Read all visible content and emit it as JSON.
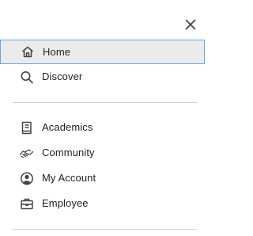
{
  "close": {
    "icon": "close-icon"
  },
  "nav": {
    "primary": [
      {
        "label": "Home",
        "icon": "home-icon",
        "active": true
      },
      {
        "label": "Discover",
        "icon": "search-icon",
        "active": false
      }
    ],
    "secondary": [
      {
        "label": "Academics",
        "icon": "book-icon"
      },
      {
        "label": "Community",
        "icon": "handshake-icon"
      },
      {
        "label": "My Account",
        "icon": "account-circle-icon"
      },
      {
        "label": "Employee",
        "icon": "briefcase-icon"
      }
    ]
  },
  "colors": {
    "active_bg": "#ebebeb",
    "active_border": "#62a7e6",
    "text": "#1f1f1f",
    "icon": "#444444",
    "divider": "#d2d2d2"
  }
}
